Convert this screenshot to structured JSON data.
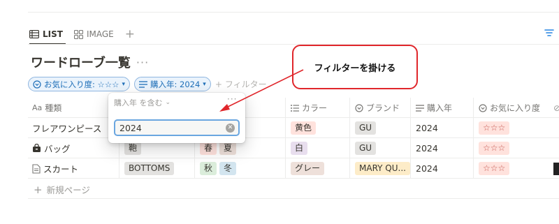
{
  "tabs": [
    {
      "label": "LIST",
      "icon": "list-icon",
      "active": true
    },
    {
      "label": "IMAGE",
      "icon": "gallery-icon",
      "active": false
    }
  ],
  "database": {
    "title": "ワードローブ一覧",
    "more": "···"
  },
  "filters": {
    "chip1": "お気に入り度: ☆☆☆",
    "chip2": "購入年: 2024",
    "add_label": "フィルター"
  },
  "table": {
    "headers": {
      "name": "種類",
      "name_prefix": "Aa",
      "color": "カラー",
      "brand": "ブランド",
      "year": "購入年",
      "fav": "お気に入り度"
    },
    "rows": [
      {
        "name": "フレアワンピース",
        "color": "黄色",
        "brand": "GU",
        "year": "2024",
        "fav": "☆☆☆"
      },
      {
        "name": "バッグ",
        "category": "鞄",
        "season1": "春",
        "season2": "夏",
        "color": "白",
        "brand": "GU",
        "year": "2024",
        "fav": "☆☆☆"
      },
      {
        "name": "スカート",
        "category": "BOTTOMS",
        "season1": "秋",
        "season2": "冬",
        "color": "グレー",
        "brand": "MARY QU...",
        "year": "2024",
        "fav": "☆☆☆"
      }
    ],
    "new_page": "新規ページ"
  },
  "popup": {
    "header": "購入年 を含む",
    "input_value": "2024",
    "dots": "···"
  },
  "annotation": {
    "text": "フィルターを掛ける",
    "color": "#e0262b"
  },
  "colors": {
    "accent": "#2383e2",
    "chip_bg": "#eaf3fc",
    "chip_text": "#1f6fb8"
  }
}
